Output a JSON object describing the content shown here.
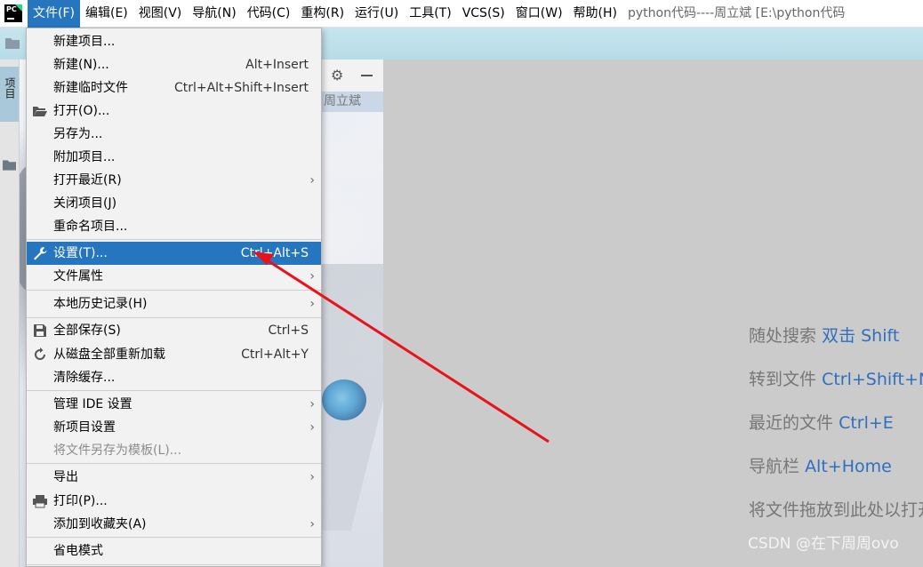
{
  "menubar": {
    "items": [
      {
        "label": "文件(F)"
      },
      {
        "label": "编辑(E)"
      },
      {
        "label": "视图(V)"
      },
      {
        "label": "导航(N)"
      },
      {
        "label": "代码(C)"
      },
      {
        "label": "重构(R)"
      },
      {
        "label": "运行(U)"
      },
      {
        "label": "工具(T)"
      },
      {
        "label": "VCS(S)"
      },
      {
        "label": "窗口(W)"
      },
      {
        "label": "帮助(H)"
      }
    ],
    "active_index": 0,
    "window_title": "python代码----周立斌 [E:\\python代码"
  },
  "left_stripe": {
    "tab_label": "项目"
  },
  "project_panel": {
    "project_name": "周立斌"
  },
  "file_menu": {
    "items": [
      {
        "label": "新建项目...",
        "shortcut": "",
        "submenu": false
      },
      {
        "label": "新建(N)...",
        "shortcut": "Alt+Insert",
        "submenu": false
      },
      {
        "label": "新建临时文件",
        "shortcut": "Ctrl+Alt+Shift+Insert",
        "submenu": false
      },
      {
        "label": "打开(O)...",
        "shortcut": "",
        "submenu": false,
        "icon": "folder-open-icon"
      },
      {
        "label": "另存为...",
        "shortcut": "",
        "submenu": false
      },
      {
        "label": "附加项目...",
        "shortcut": "",
        "submenu": false
      },
      {
        "label": "打开最近(R)",
        "shortcut": "",
        "submenu": true
      },
      {
        "label": "关闭项目(J)",
        "shortcut": "",
        "submenu": false
      },
      {
        "label": "重命名项目...",
        "shortcut": "",
        "submenu": false
      },
      {
        "label": "设置(T)...",
        "shortcut": "Ctrl+Alt+S",
        "submenu": false,
        "icon": "wrench-icon",
        "highlighted": true
      },
      {
        "label": "文件属性",
        "shortcut": "",
        "submenu": true
      },
      {
        "label": "本地历史记录(H)",
        "shortcut": "",
        "submenu": true
      },
      {
        "label": "全部保存(S)",
        "shortcut": "Ctrl+S",
        "submenu": false,
        "icon": "save-icon"
      },
      {
        "label": "从磁盘全部重新加载",
        "shortcut": "Ctrl+Alt+Y",
        "submenu": false,
        "icon": "reload-icon"
      },
      {
        "label": "清除缓存...",
        "shortcut": "",
        "submenu": false
      },
      {
        "label": "管理 IDE 设置",
        "shortcut": "",
        "submenu": true
      },
      {
        "label": "新项目设置",
        "shortcut": "",
        "submenu": true
      },
      {
        "label": "将文件另存为模板(L)...",
        "shortcut": "",
        "submenu": false,
        "disabled": true
      },
      {
        "label": "导出",
        "shortcut": "",
        "submenu": true
      },
      {
        "label": "打印(P)...",
        "shortcut": "",
        "submenu": false,
        "icon": "print-icon"
      },
      {
        "label": "添加到收藏夹(A)",
        "shortcut": "",
        "submenu": true
      },
      {
        "label": "省电模式",
        "shortcut": "",
        "submenu": false
      }
    ]
  },
  "editor_hints": [
    {
      "text": "随处搜索",
      "key": "双击 Shift"
    },
    {
      "text": "转到文件",
      "key": "Ctrl+Shift+N"
    },
    {
      "text": "最近的文件",
      "key": "Ctrl+E"
    },
    {
      "text": "导航栏",
      "key": "Alt+Home"
    },
    {
      "text": "将文件拖放到此处以打开",
      "key": ""
    }
  ],
  "watermark": "CSDN @在下周周ovo",
  "colors": {
    "menu_highlight": "#2675bf",
    "hint_key": "#2f6fbf",
    "arrow": "#e8131a"
  }
}
